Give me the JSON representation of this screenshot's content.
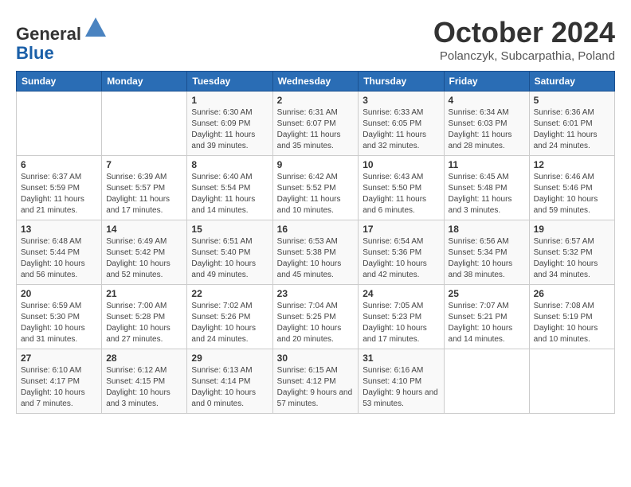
{
  "header": {
    "logo_line1": "General",
    "logo_line2": "Blue",
    "month": "October 2024",
    "location": "Polanczyk, Subcarpathia, Poland"
  },
  "weekdays": [
    "Sunday",
    "Monday",
    "Tuesday",
    "Wednesday",
    "Thursday",
    "Friday",
    "Saturday"
  ],
  "weeks": [
    [
      {
        "day": "",
        "detail": ""
      },
      {
        "day": "",
        "detail": ""
      },
      {
        "day": "1",
        "detail": "Sunrise: 6:30 AM\nSunset: 6:09 PM\nDaylight: 11 hours and 39 minutes."
      },
      {
        "day": "2",
        "detail": "Sunrise: 6:31 AM\nSunset: 6:07 PM\nDaylight: 11 hours and 35 minutes."
      },
      {
        "day": "3",
        "detail": "Sunrise: 6:33 AM\nSunset: 6:05 PM\nDaylight: 11 hours and 32 minutes."
      },
      {
        "day": "4",
        "detail": "Sunrise: 6:34 AM\nSunset: 6:03 PM\nDaylight: 11 hours and 28 minutes."
      },
      {
        "day": "5",
        "detail": "Sunrise: 6:36 AM\nSunset: 6:01 PM\nDaylight: 11 hours and 24 minutes."
      }
    ],
    [
      {
        "day": "6",
        "detail": "Sunrise: 6:37 AM\nSunset: 5:59 PM\nDaylight: 11 hours and 21 minutes."
      },
      {
        "day": "7",
        "detail": "Sunrise: 6:39 AM\nSunset: 5:57 PM\nDaylight: 11 hours and 17 minutes."
      },
      {
        "day": "8",
        "detail": "Sunrise: 6:40 AM\nSunset: 5:54 PM\nDaylight: 11 hours and 14 minutes."
      },
      {
        "day": "9",
        "detail": "Sunrise: 6:42 AM\nSunset: 5:52 PM\nDaylight: 11 hours and 10 minutes."
      },
      {
        "day": "10",
        "detail": "Sunrise: 6:43 AM\nSunset: 5:50 PM\nDaylight: 11 hours and 6 minutes."
      },
      {
        "day": "11",
        "detail": "Sunrise: 6:45 AM\nSunset: 5:48 PM\nDaylight: 11 hours and 3 minutes."
      },
      {
        "day": "12",
        "detail": "Sunrise: 6:46 AM\nSunset: 5:46 PM\nDaylight: 10 hours and 59 minutes."
      }
    ],
    [
      {
        "day": "13",
        "detail": "Sunrise: 6:48 AM\nSunset: 5:44 PM\nDaylight: 10 hours and 56 minutes."
      },
      {
        "day": "14",
        "detail": "Sunrise: 6:49 AM\nSunset: 5:42 PM\nDaylight: 10 hours and 52 minutes."
      },
      {
        "day": "15",
        "detail": "Sunrise: 6:51 AM\nSunset: 5:40 PM\nDaylight: 10 hours and 49 minutes."
      },
      {
        "day": "16",
        "detail": "Sunrise: 6:53 AM\nSunset: 5:38 PM\nDaylight: 10 hours and 45 minutes."
      },
      {
        "day": "17",
        "detail": "Sunrise: 6:54 AM\nSunset: 5:36 PM\nDaylight: 10 hours and 42 minutes."
      },
      {
        "day": "18",
        "detail": "Sunrise: 6:56 AM\nSunset: 5:34 PM\nDaylight: 10 hours and 38 minutes."
      },
      {
        "day": "19",
        "detail": "Sunrise: 6:57 AM\nSunset: 5:32 PM\nDaylight: 10 hours and 34 minutes."
      }
    ],
    [
      {
        "day": "20",
        "detail": "Sunrise: 6:59 AM\nSunset: 5:30 PM\nDaylight: 10 hours and 31 minutes."
      },
      {
        "day": "21",
        "detail": "Sunrise: 7:00 AM\nSunset: 5:28 PM\nDaylight: 10 hours and 27 minutes."
      },
      {
        "day": "22",
        "detail": "Sunrise: 7:02 AM\nSunset: 5:26 PM\nDaylight: 10 hours and 24 minutes."
      },
      {
        "day": "23",
        "detail": "Sunrise: 7:04 AM\nSunset: 5:25 PM\nDaylight: 10 hours and 20 minutes."
      },
      {
        "day": "24",
        "detail": "Sunrise: 7:05 AM\nSunset: 5:23 PM\nDaylight: 10 hours and 17 minutes."
      },
      {
        "day": "25",
        "detail": "Sunrise: 7:07 AM\nSunset: 5:21 PM\nDaylight: 10 hours and 14 minutes."
      },
      {
        "day": "26",
        "detail": "Sunrise: 7:08 AM\nSunset: 5:19 PM\nDaylight: 10 hours and 10 minutes."
      }
    ],
    [
      {
        "day": "27",
        "detail": "Sunrise: 6:10 AM\nSunset: 4:17 PM\nDaylight: 10 hours and 7 minutes."
      },
      {
        "day": "28",
        "detail": "Sunrise: 6:12 AM\nSunset: 4:15 PM\nDaylight: 10 hours and 3 minutes."
      },
      {
        "day": "29",
        "detail": "Sunrise: 6:13 AM\nSunset: 4:14 PM\nDaylight: 10 hours and 0 minutes."
      },
      {
        "day": "30",
        "detail": "Sunrise: 6:15 AM\nSunset: 4:12 PM\nDaylight: 9 hours and 57 minutes."
      },
      {
        "day": "31",
        "detail": "Sunrise: 6:16 AM\nSunset: 4:10 PM\nDaylight: 9 hours and 53 minutes."
      },
      {
        "day": "",
        "detail": ""
      },
      {
        "day": "",
        "detail": ""
      }
    ]
  ]
}
